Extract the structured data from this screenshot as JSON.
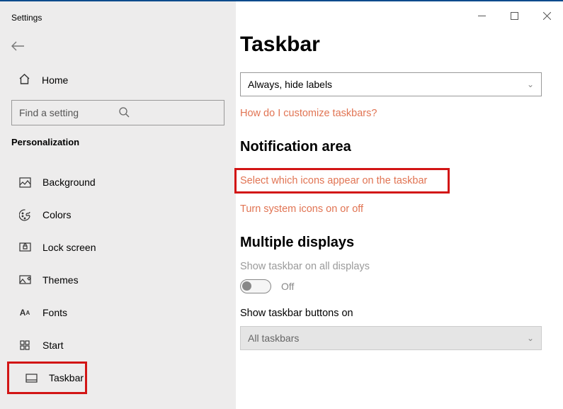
{
  "titlebar": {
    "title": "Settings"
  },
  "sidebar": {
    "home": "Home",
    "search_placeholder": "Find a setting",
    "category": "Personalization",
    "items": [
      {
        "label": "Background"
      },
      {
        "label": "Colors"
      },
      {
        "label": "Lock screen"
      },
      {
        "label": "Themes"
      },
      {
        "label": "Fonts"
      },
      {
        "label": "Start"
      },
      {
        "label": "Taskbar"
      }
    ]
  },
  "content": {
    "title": "Taskbar",
    "combine_value": "Always, hide labels",
    "link_customize": "How do I customize taskbars?",
    "section_notification": "Notification area",
    "link_select_icons": "Select which icons appear on the taskbar",
    "link_system_icons": "Turn system icons on or off",
    "section_multi": "Multiple displays",
    "show_all_label": "Show taskbar on all displays",
    "toggle_state": "Off",
    "show_buttons_label": "Show taskbar buttons on",
    "show_buttons_value": "All taskbars"
  }
}
